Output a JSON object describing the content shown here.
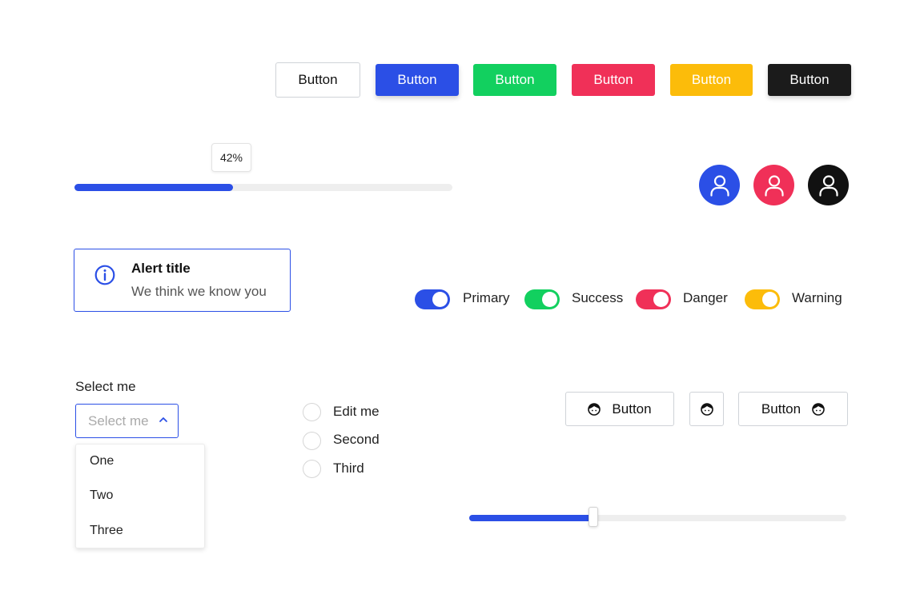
{
  "colors": {
    "primary": "#2b4fe6",
    "success": "#12d05f",
    "danger": "#f03058",
    "warning": "#fcbc0a",
    "dark": "#1b1b1b"
  },
  "buttons": [
    {
      "label": "Button",
      "variant": "outline"
    },
    {
      "label": "Button",
      "variant": "primary"
    },
    {
      "label": "Button",
      "variant": "success"
    },
    {
      "label": "Button",
      "variant": "danger"
    },
    {
      "label": "Button",
      "variant": "warning"
    },
    {
      "label": "Button",
      "variant": "dark"
    }
  ],
  "progress": {
    "value": 0.42,
    "label": "42%"
  },
  "avatars": [
    {
      "icon": "user-icon",
      "variant": "primary"
    },
    {
      "icon": "user-icon",
      "variant": "danger"
    },
    {
      "icon": "user-icon",
      "variant": "dark"
    }
  ],
  "alert": {
    "icon": "info-icon",
    "title": "Alert title",
    "text": "We think we know you"
  },
  "toggles": [
    {
      "label": "Primary",
      "on": true
    },
    {
      "label": "Success",
      "on": true
    },
    {
      "label": "Danger",
      "on": true
    },
    {
      "label": "Warning",
      "on": true
    }
  ],
  "select": {
    "label": "Select me",
    "placeholder": "Select me",
    "icon": "chevron-up-icon",
    "options": [
      "One",
      "Two",
      "Three"
    ]
  },
  "radios": [
    {
      "label": "Edit me",
      "checked": false
    },
    {
      "label": "Second",
      "checked": false
    },
    {
      "label": "Third",
      "checked": false
    }
  ],
  "icon_buttons": [
    {
      "label": "Button",
      "icon": "face-icon",
      "icon_position": "left"
    },
    {
      "label": "",
      "icon": "face-icon",
      "icon_position": "only"
    },
    {
      "label": "Button",
      "icon": "face-icon",
      "icon_position": "right"
    }
  ],
  "slider": {
    "value": 0.33
  }
}
